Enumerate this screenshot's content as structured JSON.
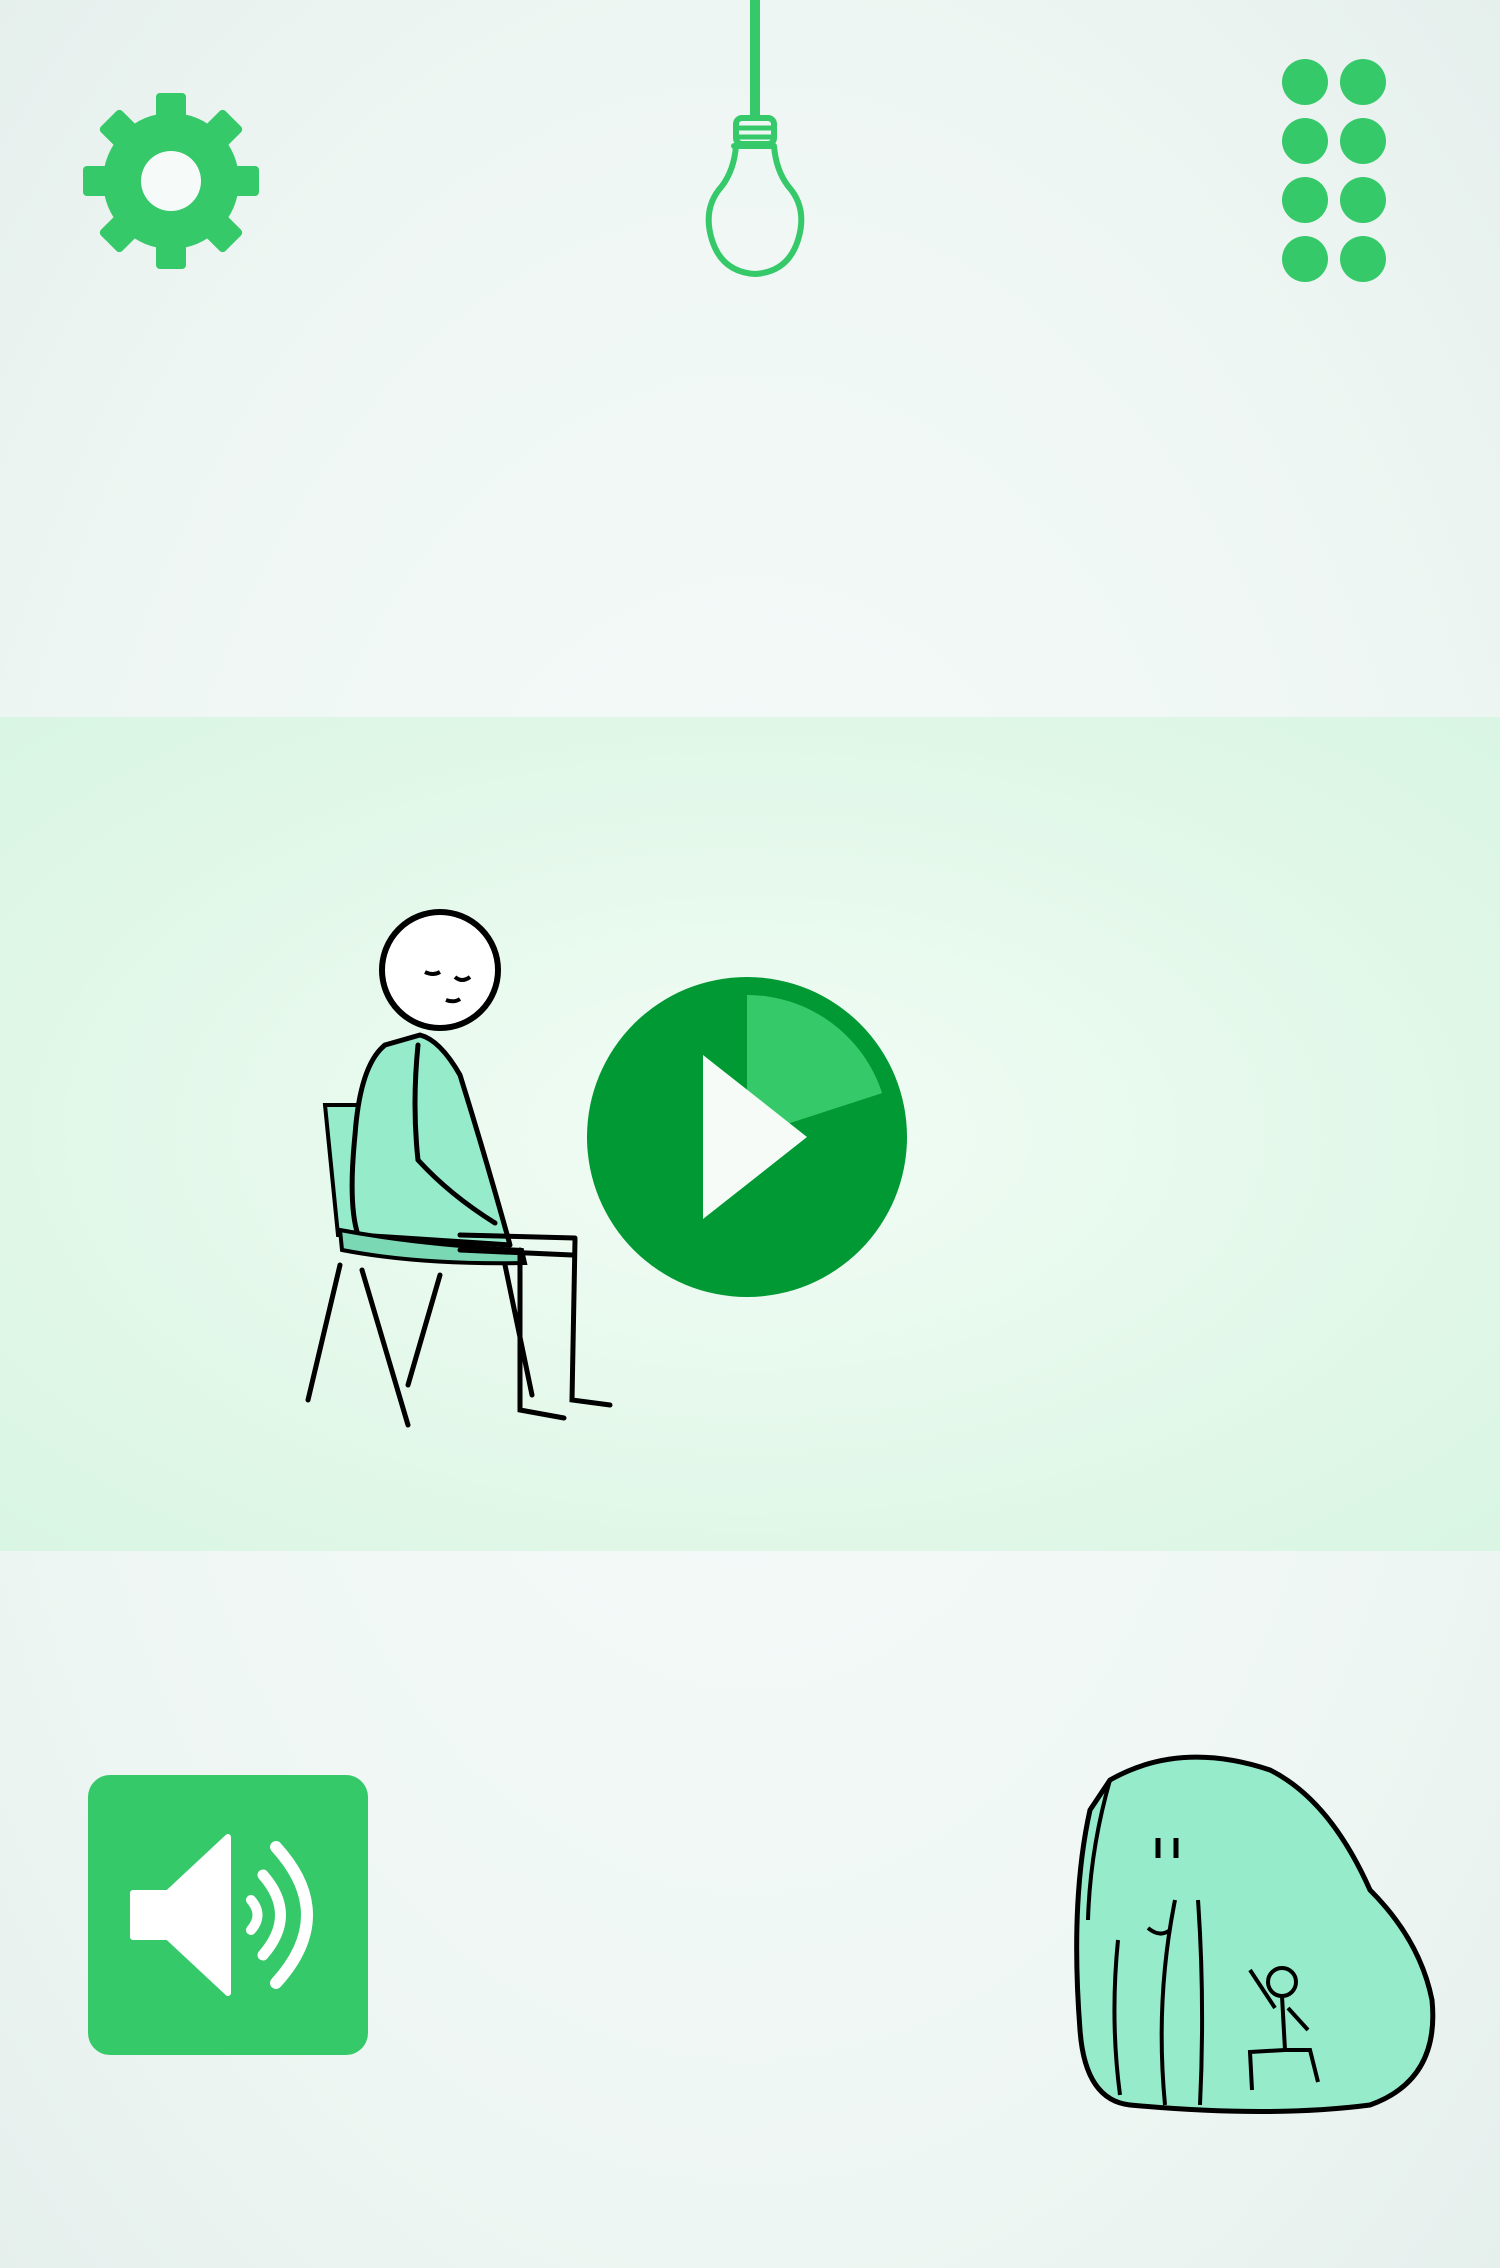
{
  "app": {
    "screen": "level-start"
  },
  "colors": {
    "accent": "#36c96a",
    "accent_dark": "#009933",
    "figure_fill": "#96ebcb",
    "stage_band": "#e3f8ea",
    "background": "#f1f8f6"
  },
  "icons": {
    "settings": "gear-icon",
    "hint": "lightbulb-icon",
    "levels": "grid-dots-icon",
    "play": "play-icon",
    "sound": "speaker-icon",
    "mascot": "elephant-icon"
  },
  "state": {
    "sound_on": true,
    "play_progress_fraction": 0.2
  }
}
